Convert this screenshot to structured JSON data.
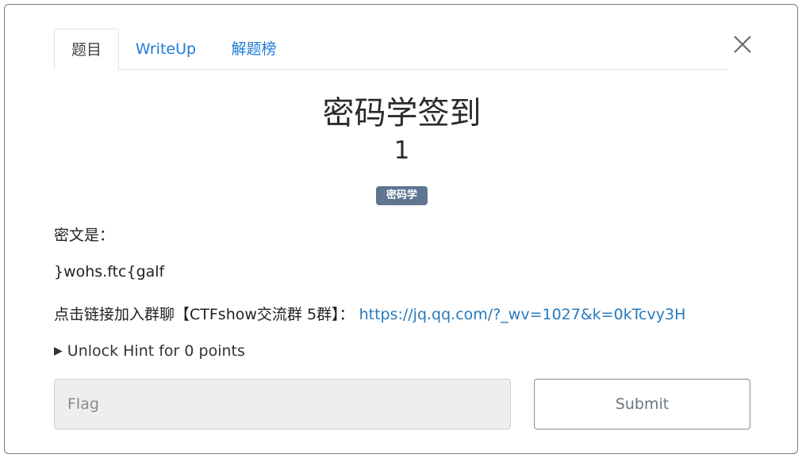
{
  "tabs": [
    {
      "label": "题目",
      "active": true
    },
    {
      "label": "WriteUp",
      "active": false
    },
    {
      "label": "解题榜",
      "active": false
    }
  ],
  "challenge": {
    "title": "密码学签到",
    "points": "1",
    "category": "密码学"
  },
  "description": {
    "line1": "密文是：",
    "line2": "}wohs.ftc{galf",
    "line3_text": "点击链接加入群聊【CTFshow交流群 5群】： ",
    "line3_link": "https://jq.qq.com/?_wv=1027&k=0kTcvy3H"
  },
  "hint": {
    "label": "Unlock Hint for 0 points",
    "icon": "triangle-right-icon"
  },
  "form": {
    "flag_placeholder": "Flag",
    "flag_value": "",
    "submit_label": "Submit"
  },
  "colors": {
    "link": "#1f7ad6",
    "badge": "#5f7590"
  },
  "close_icon": "close-icon"
}
